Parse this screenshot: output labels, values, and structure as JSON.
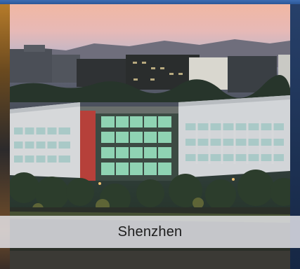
{
  "caption": {
    "label": "Shenzhen"
  },
  "colors": {
    "top_bar": "#3d6db3",
    "caption_bg": "#e8e8ee",
    "caption_text": "#1c1c1c"
  }
}
